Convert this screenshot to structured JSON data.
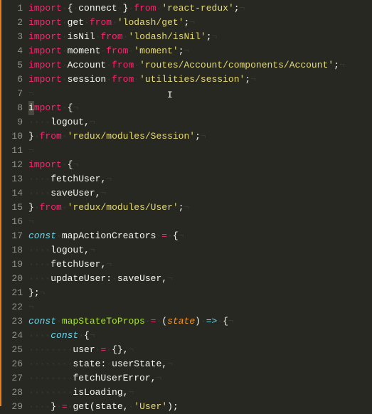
{
  "gutter": {
    "start": 1,
    "end": 29
  },
  "code": {
    "lines": [
      {
        "n": 1,
        "tokens": [
          {
            "t": "import",
            "c": "kw"
          },
          {
            "t": "·",
            "c": "ws"
          },
          {
            "t": "{",
            "c": "pn"
          },
          {
            "t": "·",
            "c": "ws"
          },
          {
            "t": "connect",
            "c": "id"
          },
          {
            "t": "·",
            "c": "ws"
          },
          {
            "t": "}",
            "c": "pn"
          },
          {
            "t": "·",
            "c": "ws"
          },
          {
            "t": "from",
            "c": "kw"
          },
          {
            "t": "·",
            "c": "ws"
          },
          {
            "t": "'react-redux'",
            "c": "str"
          },
          {
            "t": ";",
            "c": "pn"
          },
          {
            "t": "¬",
            "c": "ws"
          }
        ]
      },
      {
        "n": 2,
        "tokens": [
          {
            "t": "import",
            "c": "kw"
          },
          {
            "t": "·",
            "c": "ws"
          },
          {
            "t": "get",
            "c": "id"
          },
          {
            "t": "·",
            "c": "ws"
          },
          {
            "t": "from",
            "c": "kw"
          },
          {
            "t": "·",
            "c": "ws"
          },
          {
            "t": "'lodash/get'",
            "c": "str"
          },
          {
            "t": ";",
            "c": "pn"
          },
          {
            "t": "¬",
            "c": "ws"
          }
        ]
      },
      {
        "n": 3,
        "tokens": [
          {
            "t": "import",
            "c": "kw"
          },
          {
            "t": "·",
            "c": "ws"
          },
          {
            "t": "isNil",
            "c": "id"
          },
          {
            "t": "·",
            "c": "ws"
          },
          {
            "t": "from",
            "c": "kw"
          },
          {
            "t": "·",
            "c": "ws"
          },
          {
            "t": "'lodash/isNil'",
            "c": "str"
          },
          {
            "t": ";",
            "c": "pn"
          },
          {
            "t": "¬",
            "c": "ws"
          }
        ]
      },
      {
        "n": 4,
        "tokens": [
          {
            "t": "import",
            "c": "kw"
          },
          {
            "t": "·",
            "c": "ws"
          },
          {
            "t": "moment",
            "c": "id"
          },
          {
            "t": "·",
            "c": "ws"
          },
          {
            "t": "from",
            "c": "kw"
          },
          {
            "t": "·",
            "c": "ws"
          },
          {
            "t": "'moment'",
            "c": "str"
          },
          {
            "t": ";",
            "c": "pn"
          },
          {
            "t": "¬",
            "c": "ws"
          }
        ]
      },
      {
        "n": 5,
        "tokens": [
          {
            "t": "import",
            "c": "kw"
          },
          {
            "t": "·",
            "c": "ws"
          },
          {
            "t": "Account",
            "c": "id"
          },
          {
            "t": "·",
            "c": "ws"
          },
          {
            "t": "from",
            "c": "kw"
          },
          {
            "t": "·",
            "c": "ws"
          },
          {
            "t": "'routes/Account/components/Account'",
            "c": "str"
          },
          {
            "t": ";",
            "c": "pn"
          },
          {
            "t": "¬",
            "c": "ws"
          }
        ]
      },
      {
        "n": 6,
        "tokens": [
          {
            "t": "import",
            "c": "kw"
          },
          {
            "t": "·",
            "c": "ws"
          },
          {
            "t": "session",
            "c": "id"
          },
          {
            "t": "·",
            "c": "ws"
          },
          {
            "t": "from",
            "c": "kw"
          },
          {
            "t": "·",
            "c": "ws"
          },
          {
            "t": "'utilities/session'",
            "c": "str"
          },
          {
            "t": ";",
            "c": "pn"
          },
          {
            "t": "¬",
            "c": "ws"
          }
        ]
      },
      {
        "n": 7,
        "tokens": [
          {
            "t": "¬",
            "c": "ws"
          }
        ],
        "textCursor": true
      },
      {
        "n": 8,
        "tokens": [
          {
            "t": "i",
            "c": "kw",
            "hl": true
          },
          {
            "t": "mport",
            "c": "kw"
          },
          {
            "t": "·",
            "c": "ws"
          },
          {
            "t": "{",
            "c": "pn"
          },
          {
            "t": "¬",
            "c": "ws"
          }
        ]
      },
      {
        "n": 9,
        "tokens": [
          {
            "t": "····",
            "c": "ws"
          },
          {
            "t": "logout",
            "c": "id"
          },
          {
            "t": ",",
            "c": "pn"
          },
          {
            "t": "¬",
            "c": "ws"
          }
        ]
      },
      {
        "n": 10,
        "tokens": [
          {
            "t": "}",
            "c": "pn"
          },
          {
            "t": "·",
            "c": "ws"
          },
          {
            "t": "from",
            "c": "kw"
          },
          {
            "t": "·",
            "c": "ws"
          },
          {
            "t": "'redux/modules/Session'",
            "c": "str"
          },
          {
            "t": ";",
            "c": "pn"
          },
          {
            "t": "¬",
            "c": "ws"
          }
        ]
      },
      {
        "n": 11,
        "tokens": [
          {
            "t": "¬",
            "c": "ws"
          }
        ]
      },
      {
        "n": 12,
        "tokens": [
          {
            "t": "import",
            "c": "kw"
          },
          {
            "t": "·",
            "c": "ws"
          },
          {
            "t": "{",
            "c": "pn"
          },
          {
            "t": "¬",
            "c": "ws"
          }
        ]
      },
      {
        "n": 13,
        "tokens": [
          {
            "t": "····",
            "c": "ws"
          },
          {
            "t": "fetchUser",
            "c": "id"
          },
          {
            "t": ",",
            "c": "pn"
          },
          {
            "t": "¬",
            "c": "ws"
          }
        ]
      },
      {
        "n": 14,
        "tokens": [
          {
            "t": "····",
            "c": "ws"
          },
          {
            "t": "saveUser",
            "c": "id"
          },
          {
            "t": ",",
            "c": "pn"
          },
          {
            "t": "¬",
            "c": "ws"
          }
        ]
      },
      {
        "n": 15,
        "tokens": [
          {
            "t": "}",
            "c": "pn"
          },
          {
            "t": "·",
            "c": "ws"
          },
          {
            "t": "from",
            "c": "kw"
          },
          {
            "t": "·",
            "c": "ws"
          },
          {
            "t": "'redux/modules/User'",
            "c": "str"
          },
          {
            "t": ";",
            "c": "pn"
          },
          {
            "t": "¬",
            "c": "ws"
          }
        ]
      },
      {
        "n": 16,
        "tokens": [
          {
            "t": "¬",
            "c": "ws"
          }
        ]
      },
      {
        "n": 17,
        "tokens": [
          {
            "t": "const",
            "c": "st"
          },
          {
            "t": "·",
            "c": "ws"
          },
          {
            "t": "mapActionCreators",
            "c": "id"
          },
          {
            "t": "·",
            "c": "ws"
          },
          {
            "t": "=",
            "c": "kw"
          },
          {
            "t": "·",
            "c": "ws"
          },
          {
            "t": "{",
            "c": "pn"
          },
          {
            "t": "¬",
            "c": "ws"
          }
        ]
      },
      {
        "n": 18,
        "tokens": [
          {
            "t": "····",
            "c": "ws"
          },
          {
            "t": "logout",
            "c": "id"
          },
          {
            "t": ",",
            "c": "pn"
          },
          {
            "t": "¬",
            "c": "ws"
          }
        ]
      },
      {
        "n": 19,
        "tokens": [
          {
            "t": "····",
            "c": "ws"
          },
          {
            "t": "fetchUser",
            "c": "id"
          },
          {
            "t": ",",
            "c": "pn"
          },
          {
            "t": "¬",
            "c": "ws"
          }
        ]
      },
      {
        "n": 20,
        "tokens": [
          {
            "t": "····",
            "c": "ws"
          },
          {
            "t": "updateUser",
            "c": "id"
          },
          {
            "t": ":",
            "c": "pn"
          },
          {
            "t": "·",
            "c": "ws"
          },
          {
            "t": "saveUser",
            "c": "id"
          },
          {
            "t": ",",
            "c": "pn"
          },
          {
            "t": "¬",
            "c": "ws"
          }
        ]
      },
      {
        "n": 21,
        "tokens": [
          {
            "t": "}",
            "c": "pn"
          },
          {
            "t": ";",
            "c": "pn"
          },
          {
            "t": "¬",
            "c": "ws"
          }
        ]
      },
      {
        "n": 22,
        "tokens": [
          {
            "t": "¬",
            "c": "ws"
          }
        ]
      },
      {
        "n": 23,
        "tokens": [
          {
            "t": "const",
            "c": "st"
          },
          {
            "t": "·",
            "c": "ws"
          },
          {
            "t": "mapStateToProps",
            "c": "fn"
          },
          {
            "t": "·",
            "c": "ws"
          },
          {
            "t": "=",
            "c": "kw"
          },
          {
            "t": "·",
            "c": "ws"
          },
          {
            "t": "(",
            "c": "pn"
          },
          {
            "t": "state",
            "c": "param"
          },
          {
            "t": ")",
            "c": "pn"
          },
          {
            "t": "·",
            "c": "ws"
          },
          {
            "t": "=>",
            "c": "st"
          },
          {
            "t": "·",
            "c": "ws"
          },
          {
            "t": "{",
            "c": "pn"
          },
          {
            "t": "¬",
            "c": "ws"
          }
        ]
      },
      {
        "n": 24,
        "tokens": [
          {
            "t": "····",
            "c": "ws"
          },
          {
            "t": "const",
            "c": "st"
          },
          {
            "t": "·",
            "c": "ws"
          },
          {
            "t": "{",
            "c": "pn"
          },
          {
            "t": "¬",
            "c": "ws"
          }
        ]
      },
      {
        "n": 25,
        "tokens": [
          {
            "t": "········",
            "c": "ws"
          },
          {
            "t": "user",
            "c": "id"
          },
          {
            "t": "·",
            "c": "ws"
          },
          {
            "t": "=",
            "c": "kw"
          },
          {
            "t": "·",
            "c": "ws"
          },
          {
            "t": "{}",
            "c": "pn"
          },
          {
            "t": ",",
            "c": "pn"
          },
          {
            "t": "¬",
            "c": "ws"
          }
        ]
      },
      {
        "n": 26,
        "tokens": [
          {
            "t": "········",
            "c": "ws"
          },
          {
            "t": "state",
            "c": "id"
          },
          {
            "t": ":",
            "c": "pn"
          },
          {
            "t": "·",
            "c": "ws"
          },
          {
            "t": "userState",
            "c": "id"
          },
          {
            "t": ",",
            "c": "pn"
          },
          {
            "t": "¬",
            "c": "ws"
          }
        ]
      },
      {
        "n": 27,
        "tokens": [
          {
            "t": "········",
            "c": "ws"
          },
          {
            "t": "fetchUserError",
            "c": "id"
          },
          {
            "t": ",",
            "c": "pn"
          },
          {
            "t": "¬",
            "c": "ws"
          }
        ]
      },
      {
        "n": 28,
        "tokens": [
          {
            "t": "········",
            "c": "ws"
          },
          {
            "t": "isLoading",
            "c": "id"
          },
          {
            "t": ",",
            "c": "pn"
          },
          {
            "t": "¬",
            "c": "ws"
          }
        ]
      },
      {
        "n": 29,
        "tokens": [
          {
            "t": "····",
            "c": "ws"
          },
          {
            "t": "}",
            "c": "pn"
          },
          {
            "t": "·",
            "c": "ws"
          },
          {
            "t": "=",
            "c": "kw"
          },
          {
            "t": "·",
            "c": "ws"
          },
          {
            "t": "get",
            "c": "id"
          },
          {
            "t": "(",
            "c": "pn"
          },
          {
            "t": "state",
            "c": "id"
          },
          {
            "t": ",",
            "c": "pn"
          },
          {
            "t": "·",
            "c": "ws"
          },
          {
            "t": "'User'",
            "c": "str"
          },
          {
            "t": ")",
            "c": "pn"
          },
          {
            "t": ";",
            "c": "pn"
          }
        ]
      }
    ]
  }
}
